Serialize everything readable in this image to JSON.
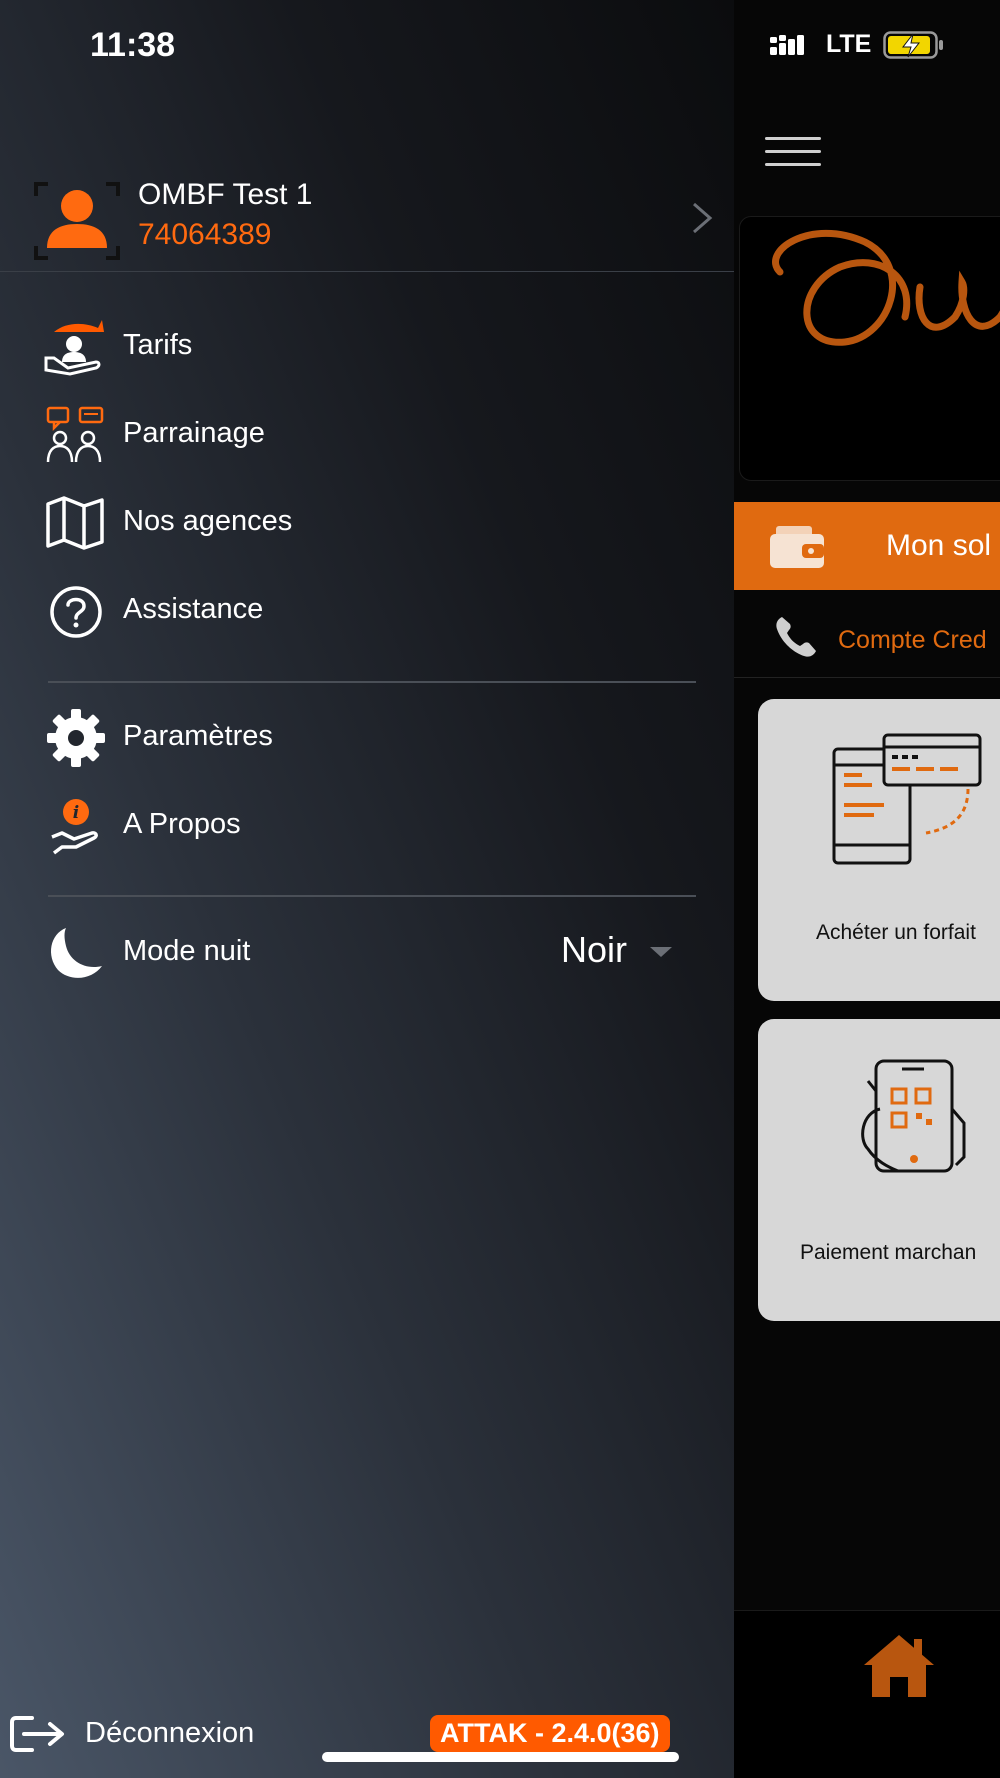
{
  "status_bar": {
    "time": "11:38",
    "network": "LTE"
  },
  "profile": {
    "name": "OMBF Test 1",
    "phone": "74064389"
  },
  "menu": {
    "items": [
      {
        "label": "Tarifs",
        "icon": "tarifs-icon"
      },
      {
        "label": "Parrainage",
        "icon": "parrainage-icon"
      },
      {
        "label": "Nos agences",
        "icon": "map-icon"
      },
      {
        "label": "Assistance",
        "icon": "help-icon"
      }
    ],
    "settings": [
      {
        "label": "Paramètres",
        "icon": "gear-icon"
      },
      {
        "label": "A Propos",
        "icon": "info-hand-icon"
      }
    ],
    "night_mode": {
      "label": "Mode nuit",
      "value": "Noir",
      "icon": "moon-icon"
    }
  },
  "footer": {
    "logout_label": "Déconnexion",
    "version": "ATTAK - 2.4.0(36)"
  },
  "background_app": {
    "balance_label": "Mon sol",
    "credit_label": "Compte Cred",
    "tiles": [
      {
        "label": "Achéter un forfait"
      },
      {
        "label": "Paiement marchan"
      }
    ]
  },
  "colors": {
    "accent": "#ff6a10",
    "drawer_dark": "#0b0c0e",
    "drawer_light": "#4a5667",
    "tile_bg": "#d7d7d7"
  }
}
